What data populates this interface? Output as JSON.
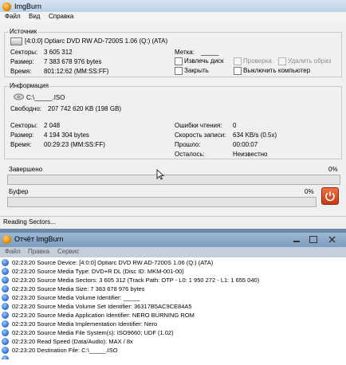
{
  "main_window": {
    "title": "ImgBurn",
    "menu": [
      "Файл",
      "Вид",
      "Справка"
    ],
    "source": {
      "group_label": "Источник",
      "device": "[4:0:0] Optiarc DVD RW AD-7200S 1.06 (Q:) (ATA)",
      "sectors_label": "Секторы:",
      "sectors_value": "3 605 312",
      "size_label": "Размер:",
      "size_value": "7 383 678 976 bytes",
      "time_label": "Время:",
      "time_value": "801:12:62 (MM:SS:FF)",
      "label_label": "Метка:",
      "label_value": "_____",
      "eject_label": "Извлечь диск",
      "close_label": "Закрыть",
      "verify_label": "Проверка",
      "delete_image_label": "Удалить образ",
      "shutdown_label": "Выключить компьютер"
    },
    "info": {
      "group_label": "Информация",
      "file": "C:\\_____.ISO",
      "free_label": "Свободно:",
      "free_value": "207 742 620 KB  (198 GB)",
      "sectors_label": "Секторы:",
      "sectors_value": "2 048",
      "size_label": "Размер:",
      "size_value": "4 194 304 bytes",
      "time_label": "Время:",
      "time_value": "00:29:23 (MM:SS:FF)",
      "errors_label": "Ошибки чтения:",
      "errors_value": "0",
      "speed_label": "Скорость записи:",
      "speed_value": "634 KB/s (0.5x)",
      "elapsed_label": "Прошло:",
      "elapsed_value": "00:00:07",
      "remaining_label": "Осталось:",
      "remaining_value": "Неизвестно"
    },
    "progress": {
      "complete_label": "Завершено",
      "complete_percent": "0%",
      "complete_fraction": 0,
      "buffer_label": "Буфер",
      "buffer_percent": "0%",
      "buffer_fraction": 0
    },
    "status_text": "Reading Sectors..."
  },
  "log_window": {
    "title": "Отчёт ImgBurn",
    "menu": [
      "Файл",
      "Правка",
      "Сервис"
    ],
    "lines": [
      "02:23:20 Source Device: [4:0:0] Optiarc DVD RW AD-7200S 1.06 (Q:) (ATA)",
      "02:23:20 Source Media Type: DVD+R DL (Disc ID: MKM-001-00)",
      "02:23:20 Source Media Sectors: 3 605 312 (Track Path: OTP - L0: 1 950 272 - L1: 1 655 040)",
      "02:23:20 Source Media Size: 7 383 678 976 bytes",
      "02:23:20 Source Media Volume Identifier: _____",
      "02:23:20 Source Media Volume Set Identifier: 36317B5AC9CE84A5",
      "02:23:20 Source Media Application Identifier: NERO BURNING ROM",
      "02:23:20 Source Media Implementation Identifier: Nero",
      "02:23:20 Source Media File System(s): ISO9660; UDF (1.02)",
      "02:23:20 Read Speed (Data/Audio): MAX / 8x",
      "02:23:20 Destination File: C:\\_____.ISO"
    ]
  },
  "colors": {
    "titlebar": "#c7d9ee",
    "progress_track": "#e3e3e3",
    "stop_button": "#d9471b",
    "log_icon": "#2f6fd0"
  }
}
